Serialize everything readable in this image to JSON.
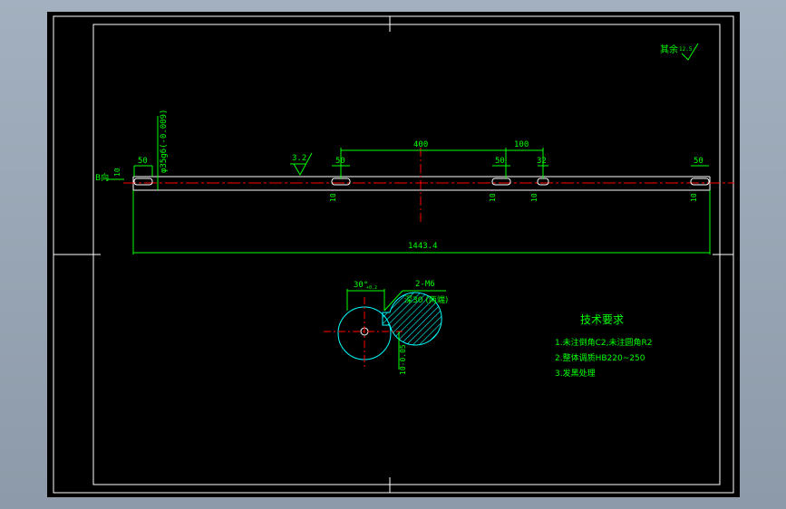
{
  "colors": {
    "background": "#000000",
    "frame": "#ffffff",
    "dimension": "#00ff00",
    "centerline": "#ff0000",
    "text": "#00ff00",
    "hatch": "#00ffff",
    "viewport_bg": "#99a6b5"
  },
  "drawing": {
    "roughness_label": "其余",
    "roughness_value": "12.5",
    "shaft": {
      "section_label": "B向",
      "diameter_label": "φ35g6(-0.009)",
      "surface_finish": "3.2",
      "overall_length": "1443.4",
      "dim_top_400": "400",
      "dim_top_100": "100",
      "keyway_widths": [
        "50",
        "50",
        "50",
        "32",
        "50"
      ],
      "keyway_depths": [
        "10",
        "10",
        "10",
        "10",
        "10"
      ]
    },
    "section": {
      "angle_label": "30°",
      "angle_sub": "+0.2",
      "thread_label": "2-M6",
      "depth_label": "深30 (两端)",
      "key_depth_label": "10-0.05"
    },
    "tech_requirements": {
      "title": "技术要求",
      "items": [
        "1.未注倒角C2,未注圆角R2",
        "2.整体调质HB220~250",
        "3.发黑处理"
      ]
    }
  }
}
